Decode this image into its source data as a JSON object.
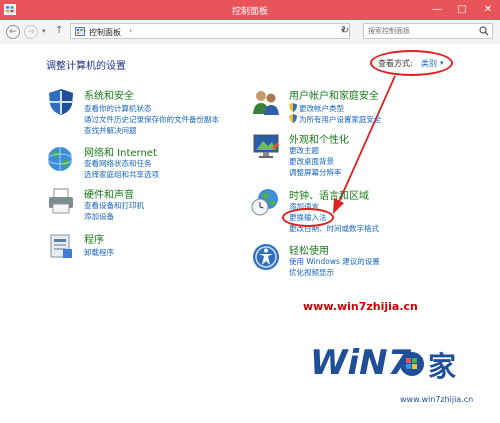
{
  "window": {
    "title": "控制面板"
  },
  "address": {
    "breadcrumb": "控制面板",
    "search_placeholder": "搜索控制面板"
  },
  "header": {
    "heading": "调整计算机的设置",
    "view_by_label": "查看方式:",
    "view_by_value": "类别"
  },
  "categories": [
    {
      "title": "系统和安全",
      "icon": "shield-system-icon",
      "links": [
        "查看你的计算机状态",
        "通过文件历史记录保存你的文件备份副本",
        "查找并解决问题"
      ]
    },
    {
      "title": "网络和 Internet",
      "icon": "network-icon",
      "links": [
        "查看网络状态和任务",
        "选择家庭组和共享选项"
      ]
    },
    {
      "title": "硬件和声音",
      "icon": "printer-icon",
      "links": [
        "查看设备和打印机",
        "添加设备"
      ]
    },
    {
      "title": "程序",
      "icon": "programs-icon",
      "links": [
        "卸载程序"
      ]
    },
    {
      "title": "用户帐户和家庭安全",
      "icon": "users-icon",
      "links": [
        "更改帐户类型",
        "为所有用户设置家庭安全"
      ]
    },
    {
      "title": "外观和个性化",
      "icon": "monitor-icon",
      "links": [
        "更改主题",
        "更改桌面背景",
        "调整屏幕分辨率"
      ]
    },
    {
      "title": "时钟、语言和区域",
      "icon": "globe-clock-icon",
      "links": [
        "添加语言",
        "更换输入法",
        "更改日期、时间或数字格式"
      ]
    },
    {
      "title": "轻松使用",
      "icon": "ease-of-access-icon",
      "links": [
        "使用 Windows 建议的设置",
        "优化视频显示"
      ]
    }
  ],
  "watermark": {
    "url": "www.win7zhijia.cn",
    "logo_text": "Win7之家"
  },
  "colors": {
    "titlebar": "#e8545a",
    "link": "#1565c0",
    "category_title": "#1a7a1a",
    "annotation": "#e02020"
  }
}
